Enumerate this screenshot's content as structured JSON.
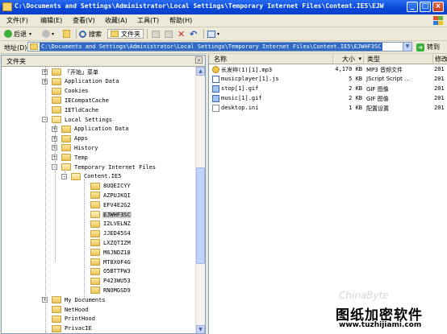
{
  "window": {
    "title": "C:\\Documents and Settings\\Administrator\\Local Settings\\Temporary Internet Files\\Content.IE5\\EJW",
    "minimize": "_",
    "maximize": "□",
    "close": "×"
  },
  "menu": [
    "文件(F)",
    "编辑(E)",
    "查看(V)",
    "收藏(A)",
    "工具(T)",
    "帮助(H)"
  ],
  "toolbar": {
    "back": "后退",
    "search": "搜索",
    "folders": "文件夹"
  },
  "address": {
    "label": "地址(D)",
    "value": "C:\\Documents and Settings\\Administrator\\Local Settings\\Temporary Internet Files\\Content.IE5\\EJWHF3SC",
    "go": "转到"
  },
  "folders_pane": {
    "title": "文件夹",
    "close": "×"
  },
  "tree": [
    {
      "label": "「开始」菜单",
      "level": 2,
      "expander": "+"
    },
    {
      "label": "Application Data",
      "level": 2,
      "expander": "+"
    },
    {
      "label": "Cookies",
      "level": 2,
      "expander": ""
    },
    {
      "label": "IECompatCache",
      "level": 2,
      "expander": ""
    },
    {
      "label": "IETldCache",
      "level": 2,
      "expander": ""
    },
    {
      "label": "Local Settings",
      "level": 2,
      "expander": "-"
    },
    {
      "label": "Application Data",
      "level": 3,
      "expander": "+"
    },
    {
      "label": "Apps",
      "level": 3,
      "expander": "+"
    },
    {
      "label": "History",
      "level": 3,
      "expander": "+"
    },
    {
      "label": "Temp",
      "level": 3,
      "expander": "+"
    },
    {
      "label": "Temporary Internet Files",
      "level": 3,
      "expander": "-"
    },
    {
      "label": "Content.IE5",
      "level": 4,
      "expander": "-"
    },
    {
      "label": "8UQEICYY",
      "level": 5,
      "expander": ""
    },
    {
      "label": "AZPUJKQI",
      "level": 5,
      "expander": ""
    },
    {
      "label": "EFV4E2G2",
      "level": 5,
      "expander": ""
    },
    {
      "label": "EJWHF3SC",
      "level": 5,
      "expander": "",
      "selected": true
    },
    {
      "label": "I2LVELNZ",
      "level": 5,
      "expander": ""
    },
    {
      "label": "JJED45S4",
      "level": 5,
      "expander": ""
    },
    {
      "label": "LXZQTIZM",
      "level": 5,
      "expander": ""
    },
    {
      "label": "M6JNDZ18",
      "level": 5,
      "expander": ""
    },
    {
      "label": "MT8X0F4G",
      "level": 5,
      "expander": ""
    },
    {
      "label": "O5BTTFW3",
      "level": 5,
      "expander": ""
    },
    {
      "label": "P423WU53",
      "level": 5,
      "expander": ""
    },
    {
      "label": "RNOMGSD9",
      "level": 5,
      "expander": ""
    },
    {
      "label": "My Documents",
      "level": 2,
      "expander": "+"
    },
    {
      "label": "NetHood",
      "level": 2,
      "expander": ""
    },
    {
      "label": "PrintHood",
      "level": 2,
      "expander": ""
    },
    {
      "label": "PrivacIE",
      "level": 2,
      "expander": ""
    }
  ],
  "columns": {
    "name": "名称",
    "size": "大小",
    "sort": "▾",
    "type": "类型",
    "date": "修改"
  },
  "files": [
    {
      "name": "长发辫(1)[1].mp3",
      "size": "4,170 KB",
      "type": "MP3 音频文件",
      "date": "201",
      "icon": "mp3-icon"
    },
    {
      "name": "musicplayer[1].js",
      "size": "5 KB",
      "type": "JScript Script ...",
      "date": "201",
      "icon": "script-icon"
    },
    {
      "name": "stop[1].gif",
      "size": "2 KB",
      "type": "GIF 图像",
      "date": "201",
      "icon": "gif-icon"
    },
    {
      "name": "music[1].gif",
      "size": "2 KB",
      "type": "GIF 图像",
      "date": "201",
      "icon": "gif-icon"
    },
    {
      "name": "desktop.ini",
      "size": "1 KB",
      "type": "配置设置",
      "date": "201",
      "icon": "ini-icon"
    }
  ],
  "watermark": "ChinaByte",
  "brand": {
    "name": "图纸加密软件",
    "url": "www.tuzhijiami.com"
  },
  "colors": {
    "titlebar": "#0a48d8",
    "selection": "#316ac5",
    "folder": "#e9c457",
    "window_bg": "#ece9d8"
  }
}
